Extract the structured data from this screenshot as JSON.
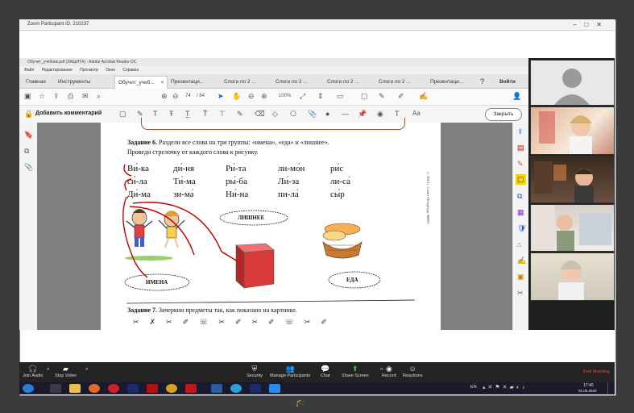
{
  "zoom": {
    "title": "Zoom Participant ID: 210237",
    "bottom_bar": {
      "join_audio": "Join Audio",
      "stop_video": "Stop Video",
      "security": "Security",
      "manage_participants": "Manage Participants",
      "chat": "Chat",
      "share_screen": "Share Screen",
      "record": "Record",
      "reactions": "Reactions",
      "end_meeting": "End Meeting"
    }
  },
  "acrobat": {
    "title": "Обучит_учебник.pdf (ЗАЩИТА) - Adobe Acrobat Reader DC",
    "menu": [
      "Файл",
      "Редактирование",
      "Просмотр",
      "Окно",
      "Справка"
    ],
    "tabs": [
      "Главная",
      "Инструменты",
      "Обучит_учеб...",
      "Презентаци...",
      "Слоги по 2 ...",
      "Слоги по 2 ...",
      "Слоги по 2 ...",
      "Слоги по 2 ...",
      "Презентаци..."
    ],
    "login": "Войти",
    "page_current": "74",
    "page_total": "/ 64",
    "zoom": "100%",
    "add_comment": "Добавить комментарий",
    "close": "Закрыть"
  },
  "page": {
    "task6_label": "Задание 6.",
    "task6_text": "Раздели все слова на три группы: «имена», «еда» и «лишнее».",
    "task6_text2": "Проведи стрелочку от каждого слова к рисунку.",
    "words": [
      [
        "Ви́-ка",
        "ди́-ня",
        "Ри́-та",
        "ли-мо́н",
        "ри́с"
      ],
      [
        "си́-ла",
        "Ти́-ма",
        "ры́-ба",
        "Ли́-за",
        "ли-са́"
      ],
      [
        "Ди́-ма",
        "зи-ма́",
        "Ни́-на",
        "пи-ла́",
        "сы́р"
      ]
    ],
    "label_names": "ИМЕНА",
    "label_extra": "ЛИШНЕЕ",
    "label_food": "ЕДА",
    "task7_label": "Задание 7.",
    "task7_text": "Зачеркни предметы так, как показано на картинке.",
    "side_text": "© 2013 г. Санкт-Петербург 98893"
  },
  "taskbar": {
    "lang": "EN",
    "time": "17:40",
    "date": "01.05.2020"
  },
  "colors": {
    "zoom_bar": "#232323",
    "end_meeting": "#e02828",
    "share_screen": "#3fbf4f",
    "acro_accent": "#b30b00"
  }
}
